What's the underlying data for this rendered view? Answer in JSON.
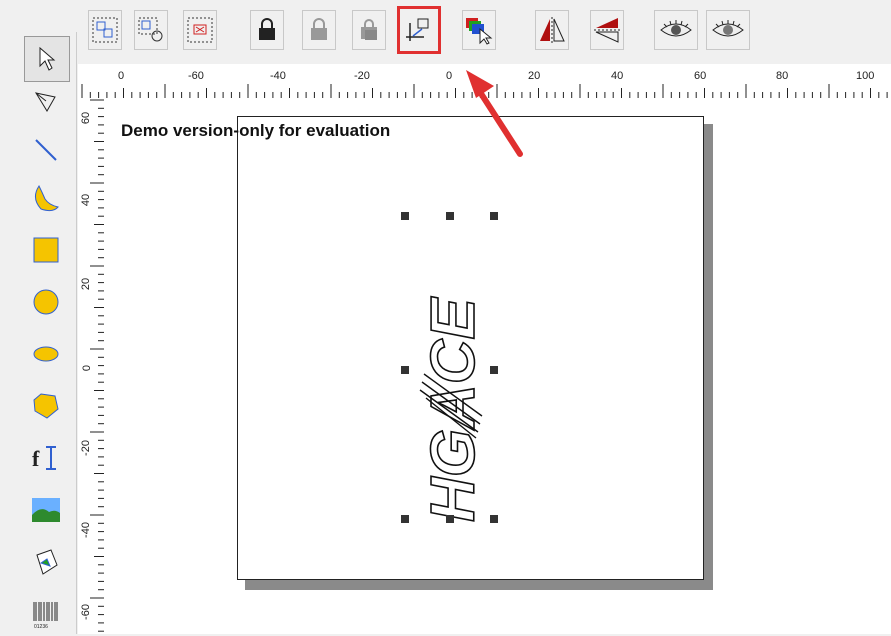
{
  "toolbar": {
    "buttons": [
      {
        "id": "group",
        "icon": "group-objects-icon"
      },
      {
        "id": "ungroup",
        "icon": "ungroup-objects-icon"
      },
      {
        "id": "delete-group",
        "icon": "delete-group-icon"
      },
      {
        "id": "lock",
        "icon": "lock-icon"
      },
      {
        "id": "unlock",
        "icon": "unlock-icon"
      },
      {
        "id": "unlock-all",
        "icon": "unlock-all-icon"
      },
      {
        "id": "set-origin",
        "icon": "set-origin-icon",
        "highlighted": true
      },
      {
        "id": "layer-order",
        "icon": "layer-order-icon"
      },
      {
        "id": "mirror-h",
        "icon": "mirror-horizontal-icon"
      },
      {
        "id": "mirror-v",
        "icon": "mirror-vertical-icon"
      },
      {
        "id": "preview-1",
        "icon": "preview-eye-icon"
      },
      {
        "id": "preview-2",
        "icon": "preview-eye-alt-icon"
      }
    ],
    "highlight_color": "#e03030"
  },
  "sidebar": {
    "tools": [
      "select-pointer-icon",
      "node-edit-icon",
      "line-tool-icon",
      "curve-tool-icon",
      "rectangle-tool-icon",
      "circle-tool-icon",
      "ellipse-tool-icon",
      "polygon-tool-icon",
      "text-tool-icon",
      "image-tool-icon",
      "vector-file-icon",
      "barcode-tool-icon"
    ],
    "shape_color": "#f5c400"
  },
  "ruler": {
    "h_labels": [
      "0",
      "-60",
      "-40",
      "-20",
      "0",
      "20",
      "40",
      "60",
      "80",
      "100"
    ],
    "v_labels": [
      "60",
      "40",
      "20",
      "0",
      "-20",
      "-40",
      "-60"
    ]
  },
  "canvas": {
    "watermark": "Demo version-only for evaluation",
    "logo_text": "HGACE",
    "barcode_label": "01236"
  }
}
